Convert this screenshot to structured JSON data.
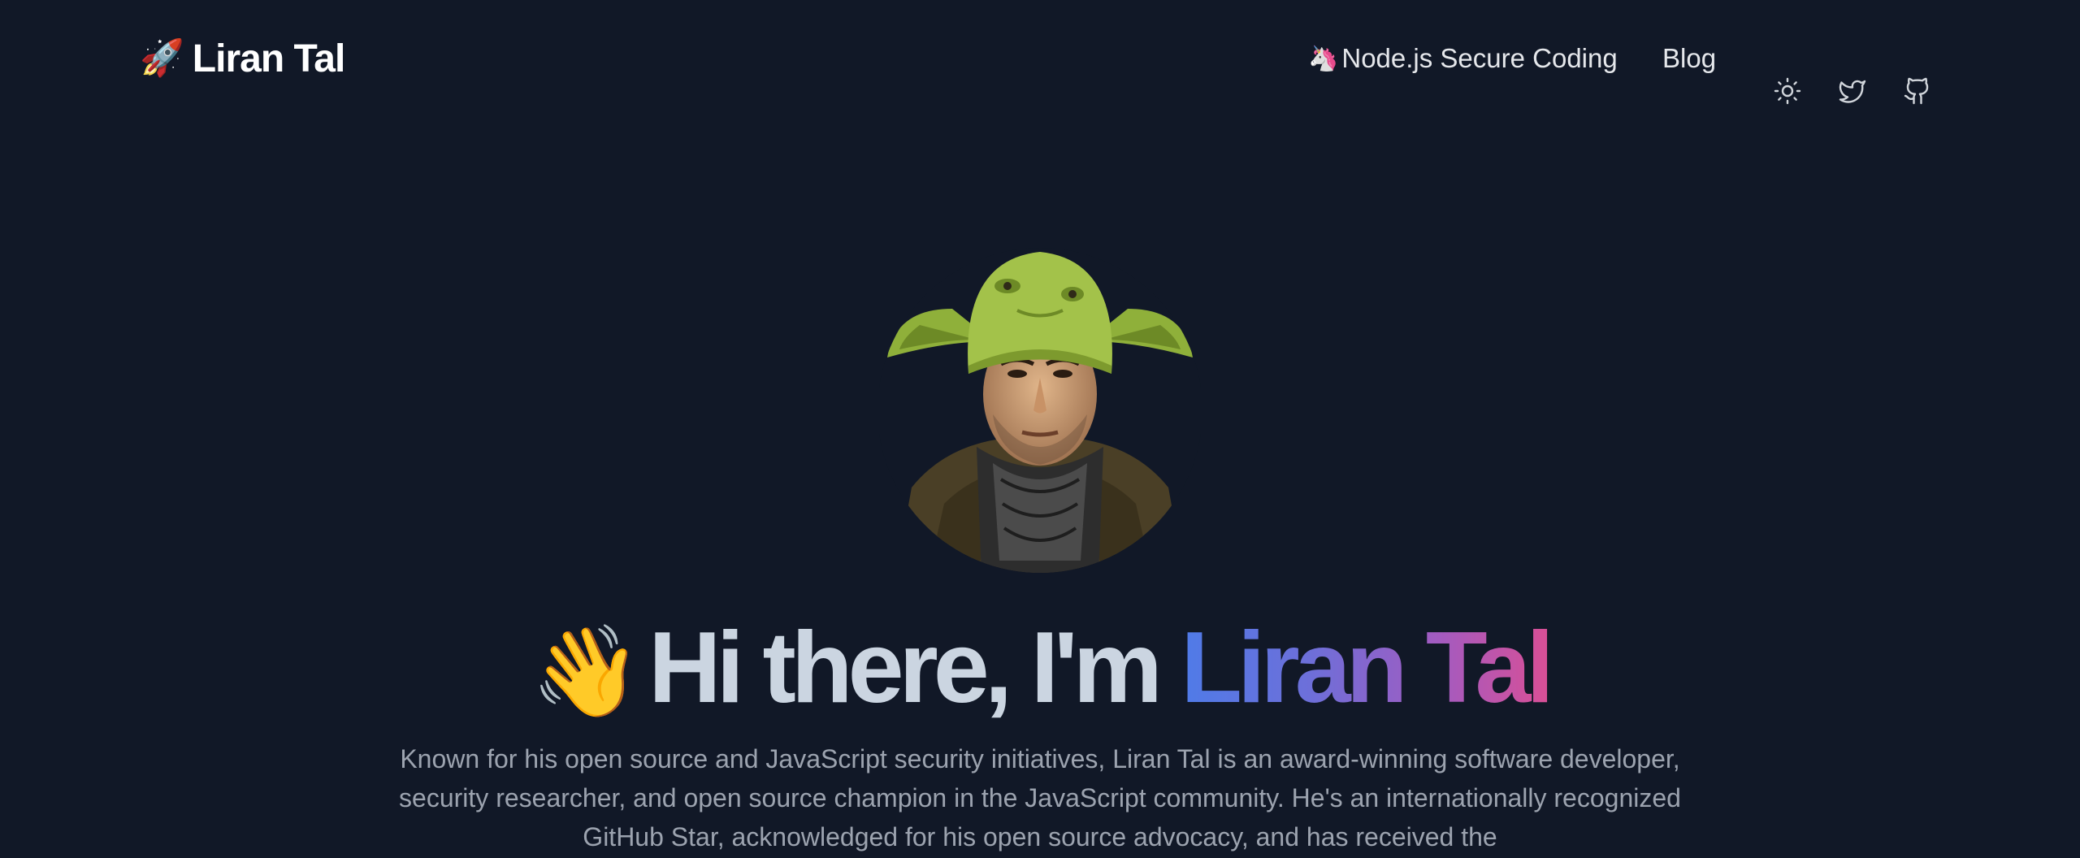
{
  "header": {
    "brand_emoji": "🚀",
    "brand_name": "Liran Tal",
    "nav": {
      "secure_emoji": "🦄",
      "secure_label": "Node.js Secure Coding",
      "blog_label": "Blog"
    },
    "icons": [
      "sun-icon",
      "twitter-icon",
      "github-icon"
    ]
  },
  "hero": {
    "wave_emoji": "👋",
    "title_prefix": "Hi there, I'm",
    "title_name": "Liran Tal",
    "description": "Known for his open source and JavaScript security initiatives, Liran Tal is an award-winning software developer, security researcher, and open source champion in the JavaScript community. He's an internationally recognized GitHub Star, acknowledged for his open source advocacy, and has received the"
  },
  "colors": {
    "background": "#111827",
    "gradient_start": "#4f7be8",
    "gradient_end": "#d94f96"
  }
}
